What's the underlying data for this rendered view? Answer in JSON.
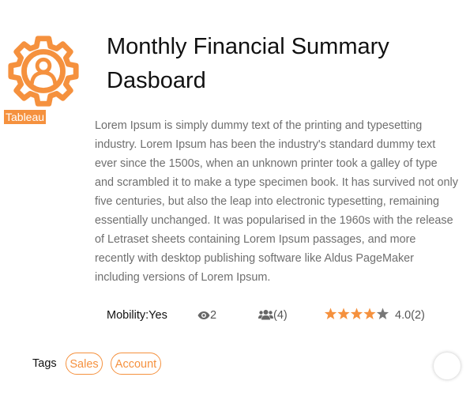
{
  "colors": {
    "accent": "#f5913e",
    "text_muted": "#6f6f6f",
    "star_empty": "#777777"
  },
  "logo": {
    "icon": "gear-user-icon",
    "badge_label": "Tableau"
  },
  "title": "Monthly Financial Summary Dasboard",
  "description": "Lorem Ipsum is simply dummy text of the printing and typesetting industry. Lorem Ipsum has been the industry's standard dummy text ever since the 1500s, when an unknown printer took a galley of type and scrambled it to make a type specimen book. It has survived not only five centuries, but also the leap into electronic typesetting, remaining essentially unchanged. It was popularised in the 1960s with the release of Letraset sheets containing Lorem Ipsum passages, and more recently with desktop publishing software like Aldus PageMaker including versions of Lorem Ipsum.",
  "stats": {
    "mobility": "Mobility:Yes",
    "views_icon": "eye-icon",
    "views": "2",
    "users_icon": "users-icon",
    "users": "(4)",
    "rating_value": 4,
    "rating_max": 5,
    "rating_text": "4.0(2)"
  },
  "tags": {
    "label": "Tags",
    "items": [
      "Sales",
      "Account"
    ]
  }
}
